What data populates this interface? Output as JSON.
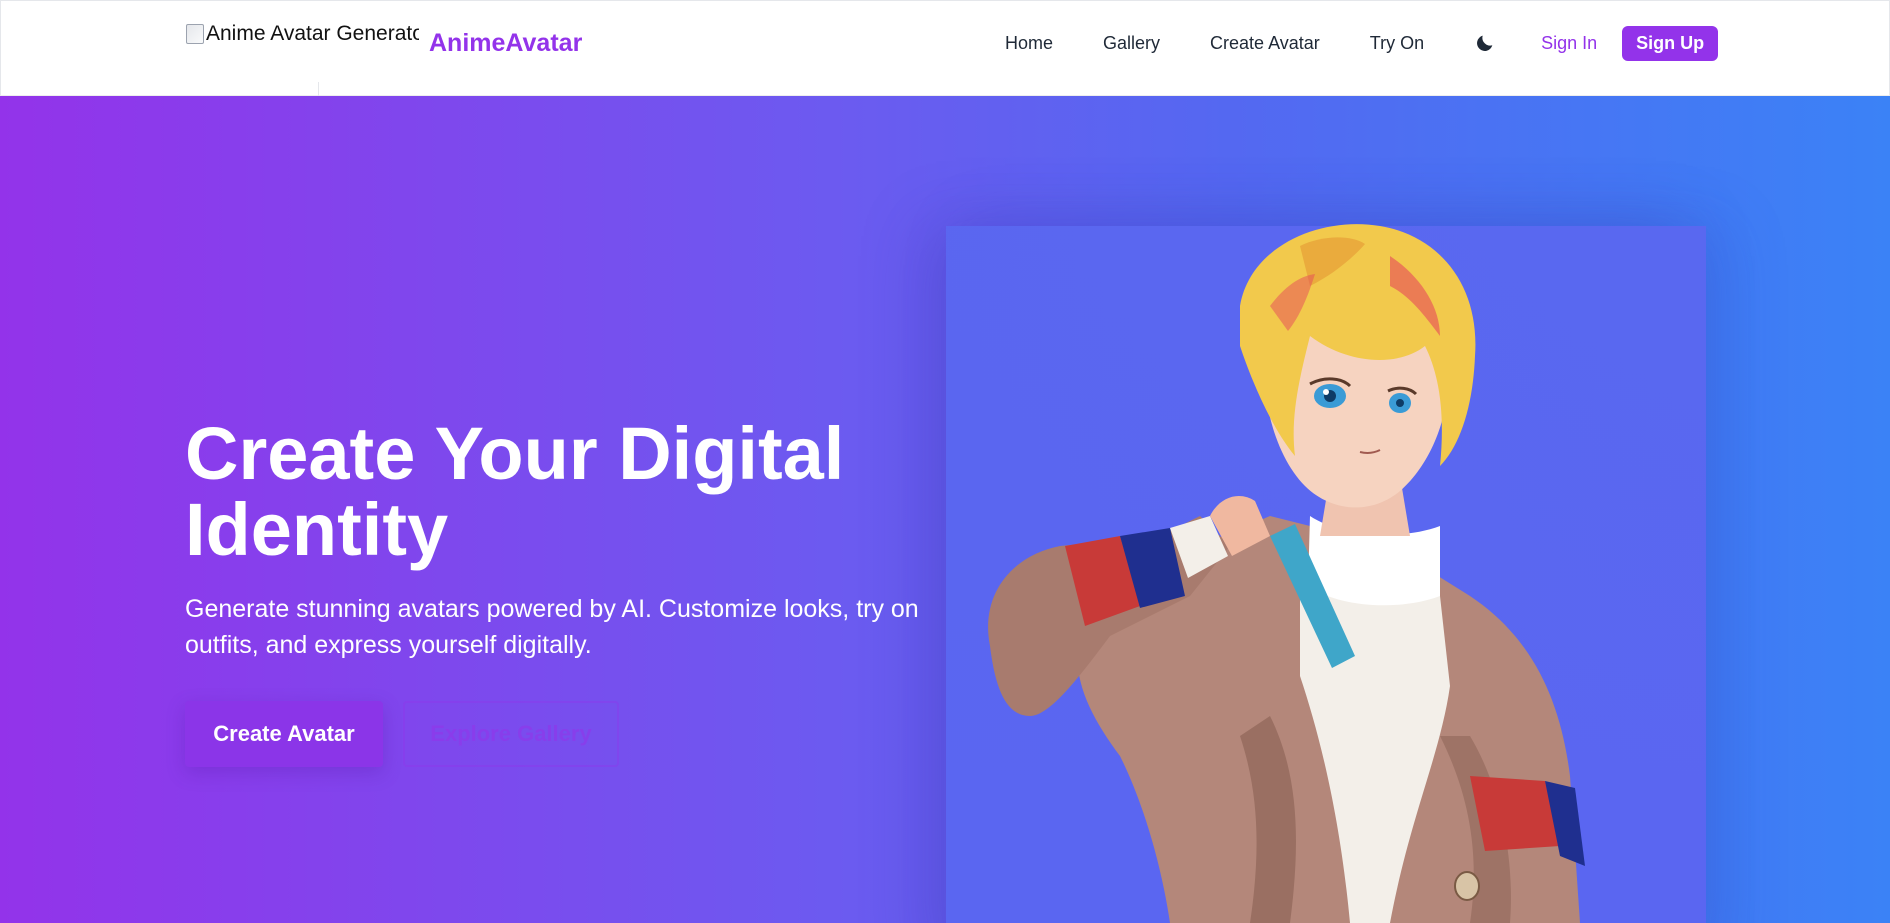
{
  "header": {
    "logo_alt": "Anime Avatar Generator",
    "brand": "AnimeAvatar",
    "nav": [
      "Home",
      "Gallery",
      "Create Avatar",
      "Try On"
    ],
    "theme_icon": "moon-icon",
    "sign_in": "Sign In",
    "sign_up": "Sign Up"
  },
  "hero": {
    "title": "Create Your Digital Identity",
    "subtitle": "Generate stunning avatars powered by AI. Customize looks, try on outfits, and express yourself digitally.",
    "primary_cta": "Create Avatar",
    "secondary_cta": "Explore Gallery",
    "image_subject": "anime boy with blonde hair and brown cardigan"
  },
  "colors": {
    "accent": "#9333ea",
    "gradient_start": "#9333ea",
    "gradient_end": "#3b82f6"
  }
}
